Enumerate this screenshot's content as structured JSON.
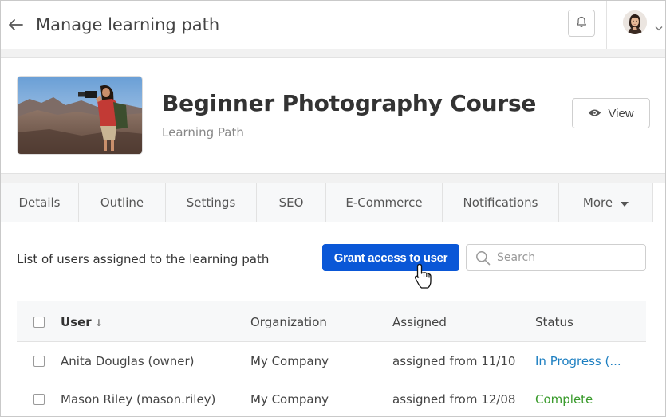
{
  "header": {
    "title": "Manage learning path",
    "back_icon": "arrow-left-icon",
    "bell_icon": "bell-icon",
    "avatar_icon": "user-avatar"
  },
  "course": {
    "title": "Beginner Photography Course",
    "subtitle": "Learning Path",
    "view_label": "View",
    "view_icon": "eye-icon"
  },
  "tabs": [
    {
      "label": "Details"
    },
    {
      "label": "Outline"
    },
    {
      "label": "Settings"
    },
    {
      "label": "SEO"
    },
    {
      "label": "E-Commerce"
    },
    {
      "label": "Notifications"
    },
    {
      "label": "More"
    }
  ],
  "toolbar": {
    "description": "List of users assigned to the learning path",
    "grant_label": "Grant access to user",
    "search_placeholder": "Search"
  },
  "table": {
    "columns": {
      "user": "User",
      "organization": "Organization",
      "assigned": "Assigned",
      "status": "Status"
    },
    "sort_indicator": "↓",
    "rows": [
      {
        "user": "Anita Douglas (owner)",
        "organization": "My Company",
        "assigned": "assigned from 11/10",
        "status": "In Progress (..."
      },
      {
        "user": "Mason Riley (mason.riley)",
        "organization": "My Company",
        "assigned": "assigned from 12/08",
        "status": "Complete"
      }
    ]
  },
  "colors": {
    "primary": "#0a57d7",
    "in_progress": "#1d7fc1",
    "complete": "#3a9b2c"
  }
}
